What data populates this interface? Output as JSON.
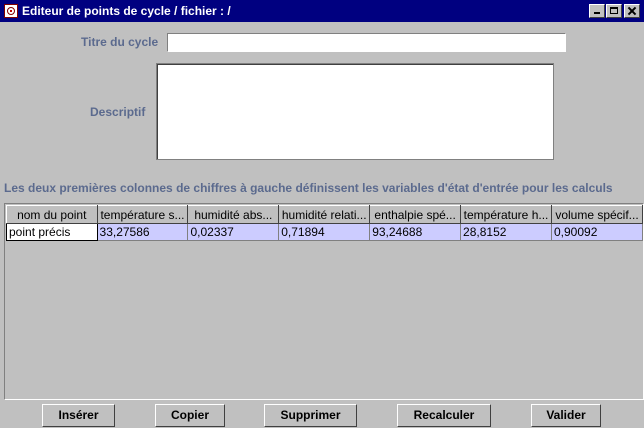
{
  "window": {
    "title": "Editeur de points de cycle / fichier :  /"
  },
  "form": {
    "cycle_title_label": "Titre du cycle",
    "cycle_title_value": "",
    "description_label": "Descriptif",
    "description_value": ""
  },
  "info_text": "Les deux premières colonnes de chiffres à gauche définissent les variables d'état d'entrée pour les calculs",
  "table": {
    "columns": [
      "nom du point",
      "température s...",
      "humidité abs...",
      "humidité relati...",
      "enthalpie spé...",
      "température h...",
      "volume spécif..."
    ],
    "rows": [
      [
        "point précis",
        "33,27586",
        "0,02337",
        "0,71894",
        "93,24688",
        "28,8152",
        "0,90092"
      ]
    ]
  },
  "buttons": {
    "insert": "Insérer",
    "copy": "Copier",
    "delete": "Supprimer",
    "recalc": "Recalculer",
    "validate": "Valider"
  }
}
